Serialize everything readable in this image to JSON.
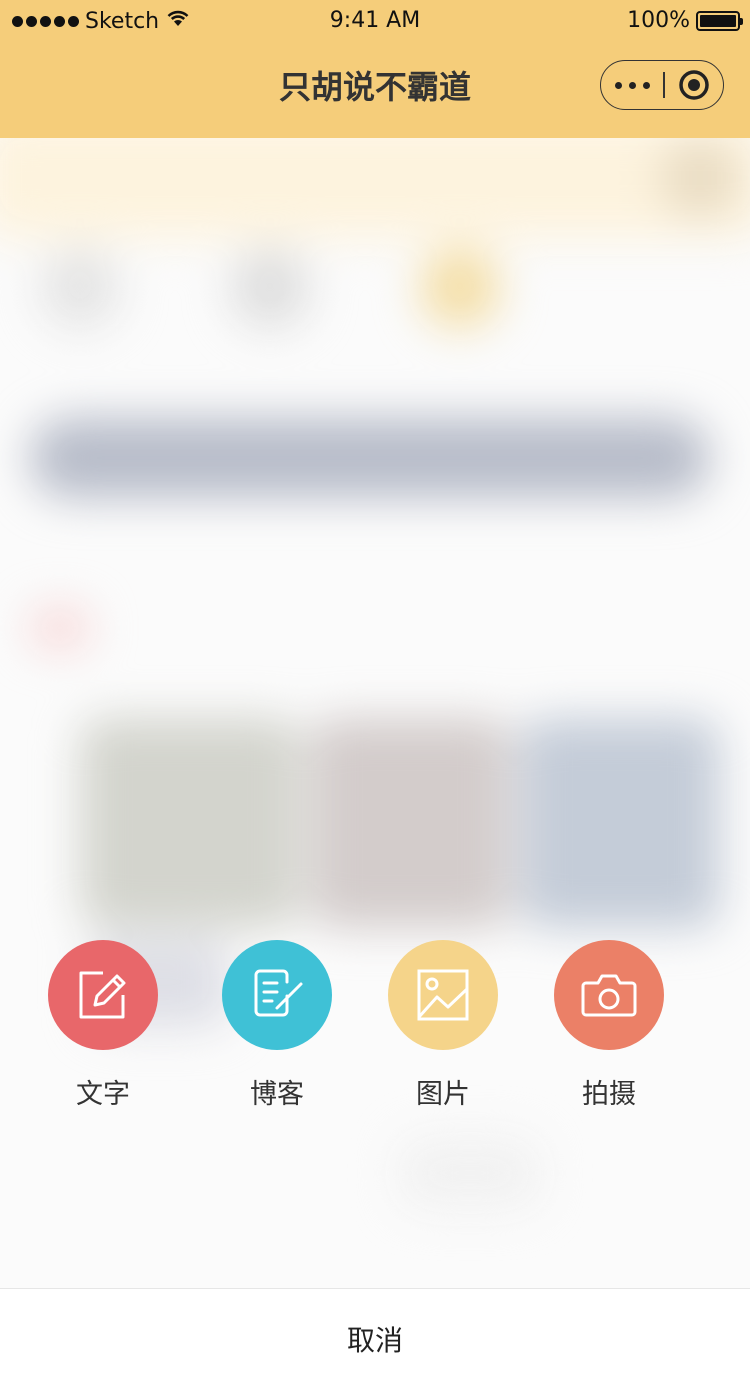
{
  "status_bar": {
    "carrier": "Sketch",
    "time": "9:41 AM",
    "battery": "100%"
  },
  "nav": {
    "title": "只胡说不霸道"
  },
  "actions": [
    {
      "label": "文字",
      "icon": "edit-icon",
      "color": "#e8676a"
    },
    {
      "label": "博客",
      "icon": "blog-icon",
      "color": "#3fc1d6"
    },
    {
      "label": "图片",
      "icon": "image-icon",
      "color": "#f5d48a"
    },
    {
      "label": "拍摄",
      "icon": "camera-icon",
      "color": "#eb8067"
    }
  ],
  "cancel": {
    "label": "取消"
  },
  "colors": {
    "nav_bg": "#f5cd7a"
  }
}
